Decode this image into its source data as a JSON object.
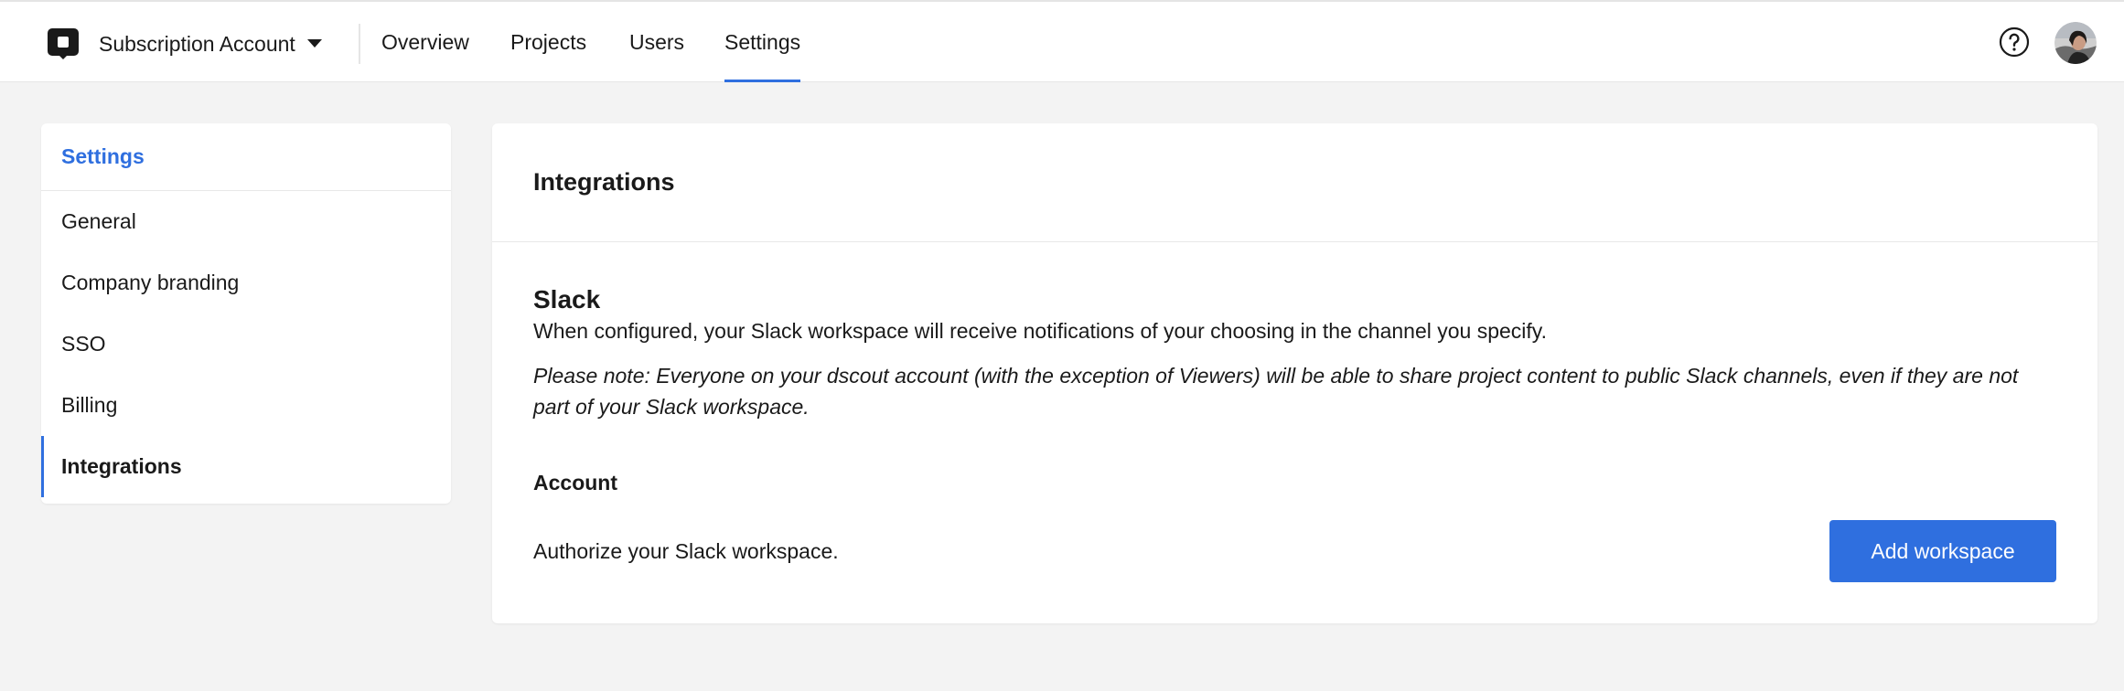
{
  "header": {
    "account_name": "Subscription Account",
    "nav_tabs": [
      {
        "label": "Overview",
        "active": false
      },
      {
        "label": "Projects",
        "active": false
      },
      {
        "label": "Users",
        "active": false
      },
      {
        "label": "Settings",
        "active": true
      }
    ],
    "help_icon": "question-circle-icon",
    "accent_color": "#2f6fdf"
  },
  "sidebar": {
    "title": "Settings",
    "items": [
      {
        "label": "General",
        "active": false
      },
      {
        "label": "Company branding",
        "active": false
      },
      {
        "label": "SSO",
        "active": false
      },
      {
        "label": "Billing",
        "active": false
      },
      {
        "label": "Integrations",
        "active": true
      }
    ]
  },
  "main": {
    "title": "Integrations",
    "slack": {
      "title": "Slack",
      "description": "When configured, your Slack workspace will receive notifications of your choosing in the channel you specify.",
      "note": "Please note: Everyone on your dscout account (with the exception of Viewers) will be able to share project content to public Slack channels, even if they are not part of your Slack workspace.",
      "account_heading": "Account",
      "authorize_text": "Authorize your Slack workspace.",
      "button_label": "Add workspace"
    }
  }
}
